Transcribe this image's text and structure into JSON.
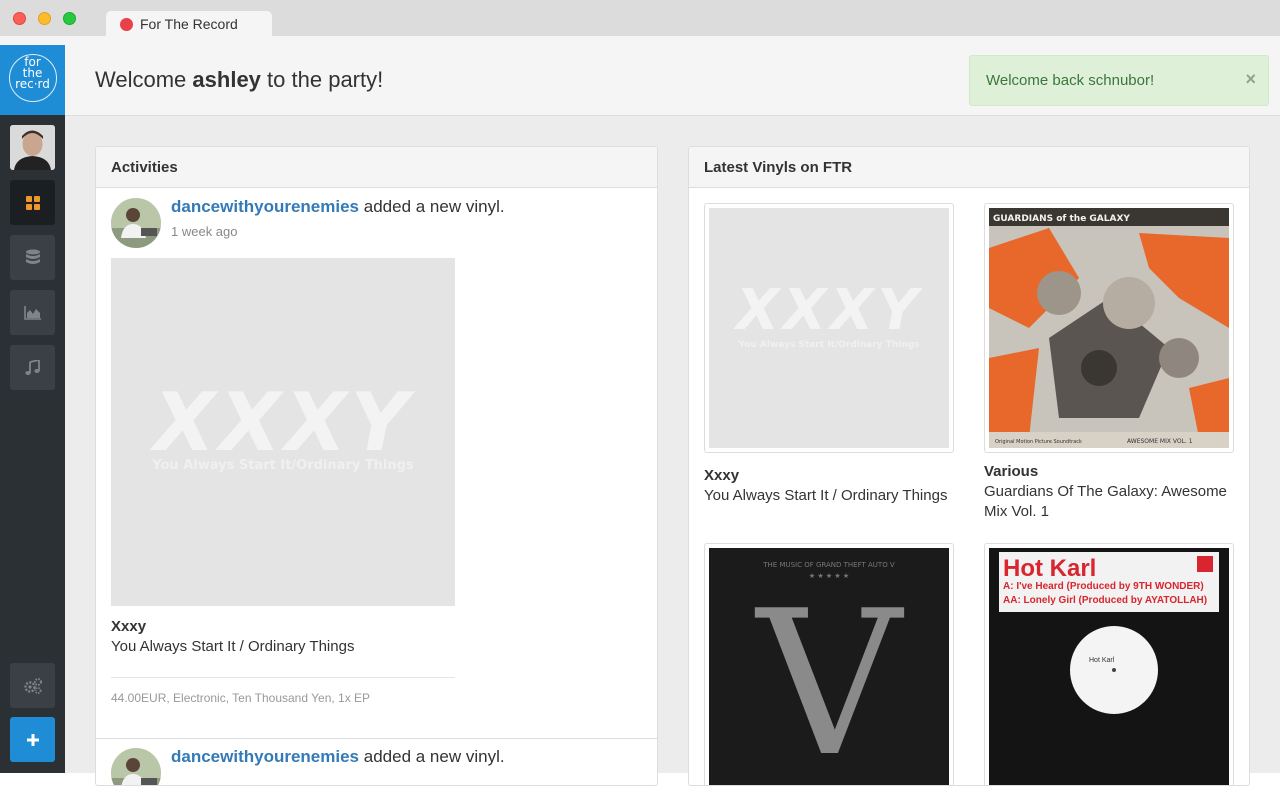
{
  "window": {
    "tab_title": "For The Record"
  },
  "logo": {
    "text_1": "for",
    "text_2": "the",
    "text_3": "rec·rd"
  },
  "sidebar": {
    "items": [
      {
        "icon": "dashboard-icon"
      },
      {
        "icon": "database-icon"
      },
      {
        "icon": "chart-icon"
      },
      {
        "icon": "music-icon"
      }
    ],
    "settings_icon": "gears-icon",
    "add_icon": "plus-icon"
  },
  "header": {
    "welcome_prefix": "Welcome",
    "username": "ashley",
    "welcome_suffix": "to the party!"
  },
  "alert": {
    "text": "Welcome back schnubor!",
    "close": "×"
  },
  "activities": {
    "title": "Activities",
    "items": [
      {
        "user": "dancewithyourenemies",
        "action": "added a new vinyl.",
        "time": "1 week ago",
        "artist": "Xxxy",
        "album": "You Always Start It / Ordinary Things",
        "meta": "44.00EUR, Electronic, Ten Thousand Yen, 1x EP"
      },
      {
        "user": "dancewithyourenemies",
        "action": "added a new vinyl."
      }
    ]
  },
  "latest": {
    "title": "Latest Vinyls on FTR",
    "items": [
      {
        "artist": "Xxxy",
        "album": "You Always Start It / Ordinary Things"
      },
      {
        "artist": "Various",
        "album_line1": "Guardians Of The Galaxy: Awesome",
        "album_line2": "Mix Vol. 1"
      },
      {
        "artist": "",
        "album": ""
      },
      {
        "artist": "",
        "album": ""
      }
    ]
  },
  "covers": {
    "xxxy_big": "XXXY",
    "xxxy_small": "You Always Start It/Ordinary Things",
    "gotg_title": "GUARDIANS of the GALAXY",
    "gotg_footer": "Original Motion Picture Soundtrack",
    "gotg_mix": "AWESOME MIX VOL. 1",
    "gta_top": "THE MUSIC OF GRAND THEFT AUTO V",
    "gta_letter": "V",
    "hk_title": "Hot Karl",
    "hk_line1": "A: I've Heard (Produced by 9TH WONDER)",
    "hk_line2": "AA: Lonely Girl (Produced by AYATOLLAH)",
    "hk_label": "Hot Karl"
  },
  "colors": {
    "brand": "#1f8dd6",
    "sidebar": "#2b3034",
    "link": "#337ab7",
    "alert_bg": "#dff0d8",
    "alert_text": "#3c763d"
  }
}
